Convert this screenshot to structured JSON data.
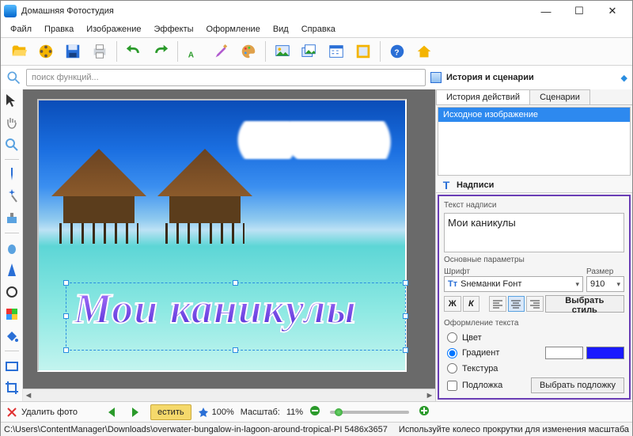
{
  "window": {
    "title": "Домашняя Фотостудия"
  },
  "menu": [
    "Файл",
    "Правка",
    "Изображение",
    "Эффекты",
    "Оформление",
    "Вид",
    "Справка"
  ],
  "search": {
    "placeholder": "поиск функций..."
  },
  "history_panel": {
    "title": "История и сценарии",
    "tabs": [
      "История действий",
      "Сценарии"
    ],
    "active_tab": 0,
    "items": [
      "Исходное изображение"
    ]
  },
  "captions_panel": {
    "title": "Надписи",
    "text_label": "Текст надписи",
    "text_value": "Мои каникулы",
    "params_label": "Основные параметры",
    "font_label": "Шрифт",
    "font_value": "Sнеманки Fонт",
    "size_label": "Размер",
    "size_value": "910",
    "bold": "Ж",
    "italic": "К",
    "style_btn": "Выбрать стиль",
    "decor_label": "Оформление текста",
    "opt_color": "Цвет",
    "opt_gradient": "Градиент",
    "opt_texture": "Текстура",
    "opt_underlay": "Подложка",
    "underlay_btn": "Выбрать подложку",
    "gradient_from": "#ffffff",
    "gradient_to": "#1a1aff"
  },
  "canvas_caption": "Мои каникулы",
  "bottom": {
    "delete": "Удалить фото",
    "fit": "естить",
    "zoom_btn": "100%",
    "scale_label": "Масштаб:",
    "scale_value": "11%"
  },
  "status": {
    "path": "C:\\Users\\ContentManager\\Downloads\\overwater-bungalow-in-lagoon-around-tropical-PI 5486x3657",
    "hint": "Используйте колесо прокрутки для изменения масштаба"
  }
}
